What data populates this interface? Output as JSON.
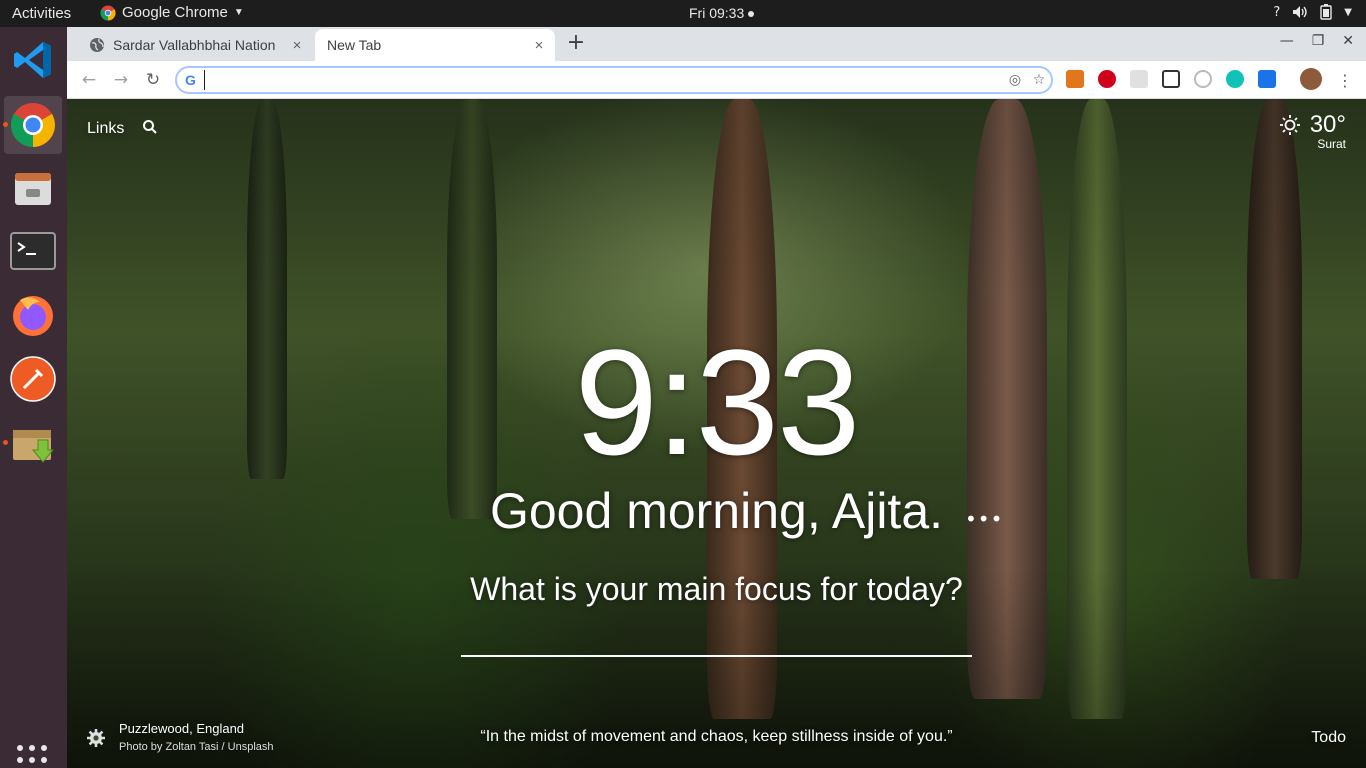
{
  "topbar": {
    "activities": "Activities",
    "app_name": "Google Chrome",
    "clock": "Fri 09:33",
    "tray_help": "?"
  },
  "dock": {
    "items": [
      "vscode-icon",
      "chrome-icon",
      "file-manager-icon",
      "terminal-icon",
      "firefox-icon",
      "postman-icon",
      "archive-manager-icon"
    ],
    "apps_grid": "show-applications-icon"
  },
  "browser": {
    "tabs": [
      {
        "title": "Sardar Vallabhbhai Nation",
        "close": "×"
      },
      {
        "title": "New Tab",
        "close": "×"
      }
    ],
    "new_tab": "+",
    "omnibox": {
      "value": "",
      "placeholder": ""
    },
    "extensions": [
      "metamask-icon",
      "adblock-plus-icon",
      "extension-icon",
      "screen-capture-icon",
      "extension-icon-2",
      "momentum-icon",
      "extension-icon-3",
      "profile-avatar"
    ],
    "ext_colors": [
      "#e2761b",
      "#d0021b",
      "#cfcfcf",
      "#333333",
      "#bbbbbb",
      "#13c2b7",
      "#1a73e8",
      "#8d5b3c"
    ]
  },
  "momentum": {
    "links": "Links",
    "weather": {
      "temp": "30°",
      "city": "Surat"
    },
    "time": "9:33",
    "greeting": "Good morning, Ajita.",
    "greeting_more": "•••",
    "focus_question": "What is your main focus for today?",
    "photo_location": "Puzzlewood, England",
    "photo_credit": "Photo by Zoltan Tasi / Unsplash",
    "quote": "“In the midst of movement and chaos, keep stillness inside of you.”",
    "todo": "Todo"
  }
}
